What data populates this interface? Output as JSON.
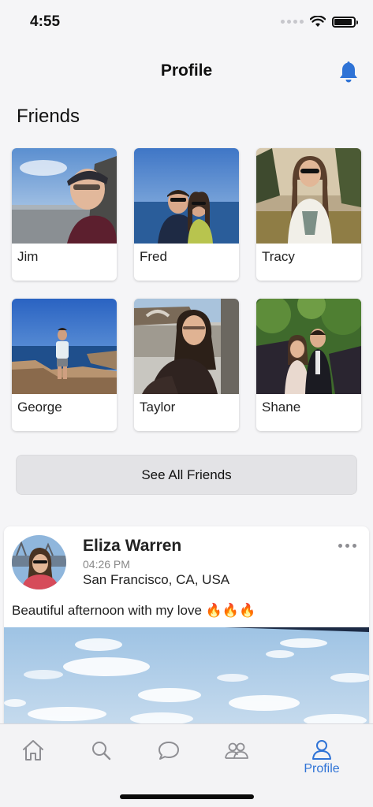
{
  "status_bar": {
    "time": "4:55"
  },
  "header": {
    "title": "Profile"
  },
  "friends": {
    "section_title": "Friends",
    "items": [
      {
        "name": "Jim"
      },
      {
        "name": "Fred"
      },
      {
        "name": "Tracy"
      },
      {
        "name": "George"
      },
      {
        "name": "Taylor"
      },
      {
        "name": "Shane"
      }
    ],
    "see_all_label": "See All Friends"
  },
  "post": {
    "author": "Eliza Warren",
    "time": "04:26 PM",
    "location": "San Francisco, CA, USA",
    "text": "Beautiful afternoon with my love 🔥🔥🔥"
  },
  "tab_bar": {
    "items": [
      {
        "icon": "home-icon",
        "label": ""
      },
      {
        "icon": "search-icon",
        "label": ""
      },
      {
        "icon": "chat-bubble-icon",
        "label": ""
      },
      {
        "icon": "friends-icon",
        "label": ""
      },
      {
        "icon": "profile-icon",
        "label": "Profile"
      }
    ]
  },
  "colors": {
    "accent": "#2f73d6",
    "background": "#f5f5f7",
    "inactive_icon": "#8e8e93"
  }
}
